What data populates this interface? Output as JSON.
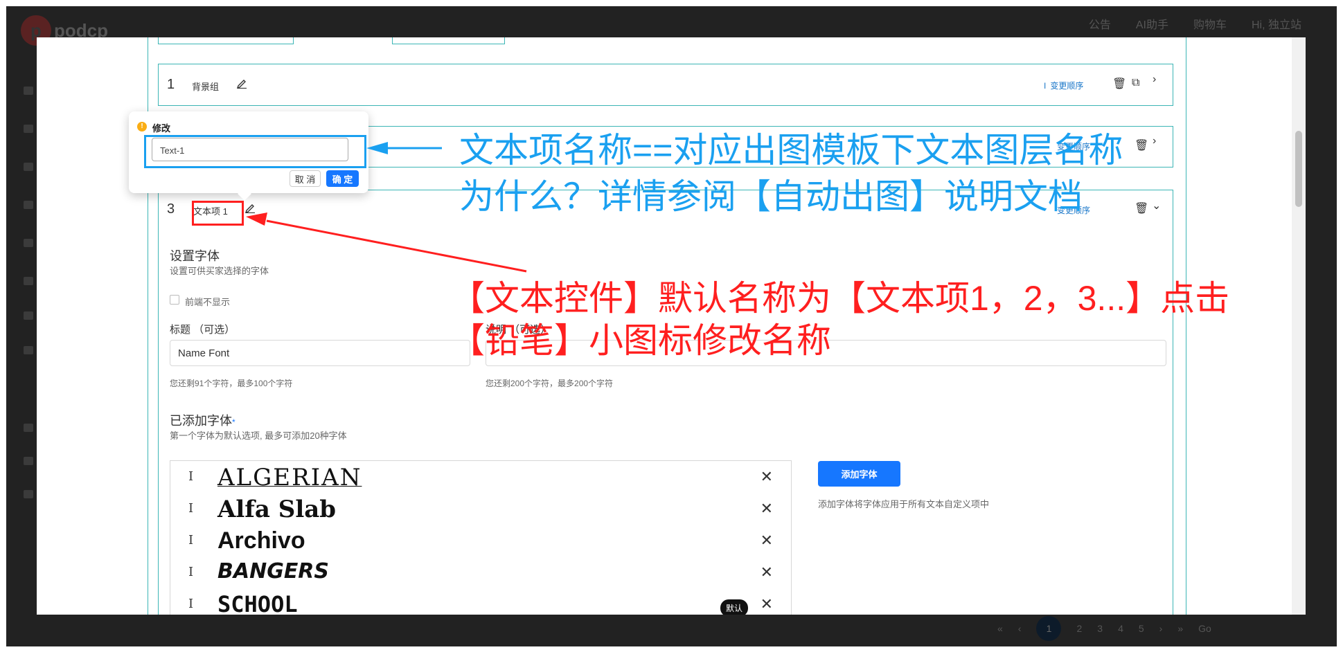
{
  "app": {
    "logo_text": "podcp"
  },
  "topnav": {
    "items": [
      "公告",
      "AI助手",
      "购物车",
      "Hi, 独立站"
    ]
  },
  "rows": [
    {
      "num": "1",
      "name": "背景组",
      "order_label": "变更顺序"
    },
    {
      "num": "3",
      "name": "文本项 1",
      "order_label": "变更顺序"
    }
  ],
  "row2_order_label": "变更顺序",
  "popup": {
    "title": "修改",
    "input_value": "Text-1",
    "cancel": "取 消",
    "ok": "确 定"
  },
  "font_section": {
    "title": "设置字体",
    "subtitle": "设置可供买家选择的字体",
    "checkbox_label": "前端不显示",
    "title_label": "标题 （可选）",
    "desc_label": "说明 （可选）",
    "title_value": "Name Font",
    "title_hint": "您还剩91个字符，最多100个字符",
    "desc_hint": "您还剩200个字符，最多200个字符"
  },
  "added_fonts": {
    "title": "已添加字体",
    "required_mark": "*",
    "subtitle": "第一个字体为默认选项, 最多可添加20种字体",
    "fonts": [
      "ALGERIAN",
      "Alfa Slab",
      "Archivo",
      "BANGERS",
      "SCHOOL"
    ],
    "default_badge": "默认",
    "add_button": "添加字体",
    "add_hint": "添加字体将字体应用于所有文本自定义项中"
  },
  "annotations": {
    "blue_line1": "文本项名称==对应出图模板下文本图层名称",
    "blue_line2": "为什么？详情参阅【自动出图】说明文档",
    "red_line1": "【文本控件】默认名称为【文本项1，2，3...】点击",
    "red_line2": "【铅笔】小图标修改名称",
    "blue_color": "#1aa0f0",
    "red_color": "#ff1f1f"
  },
  "pager": {
    "pages": [
      "1",
      "2",
      "3",
      "4",
      "5"
    ],
    "current": "1",
    "go": "Go"
  }
}
